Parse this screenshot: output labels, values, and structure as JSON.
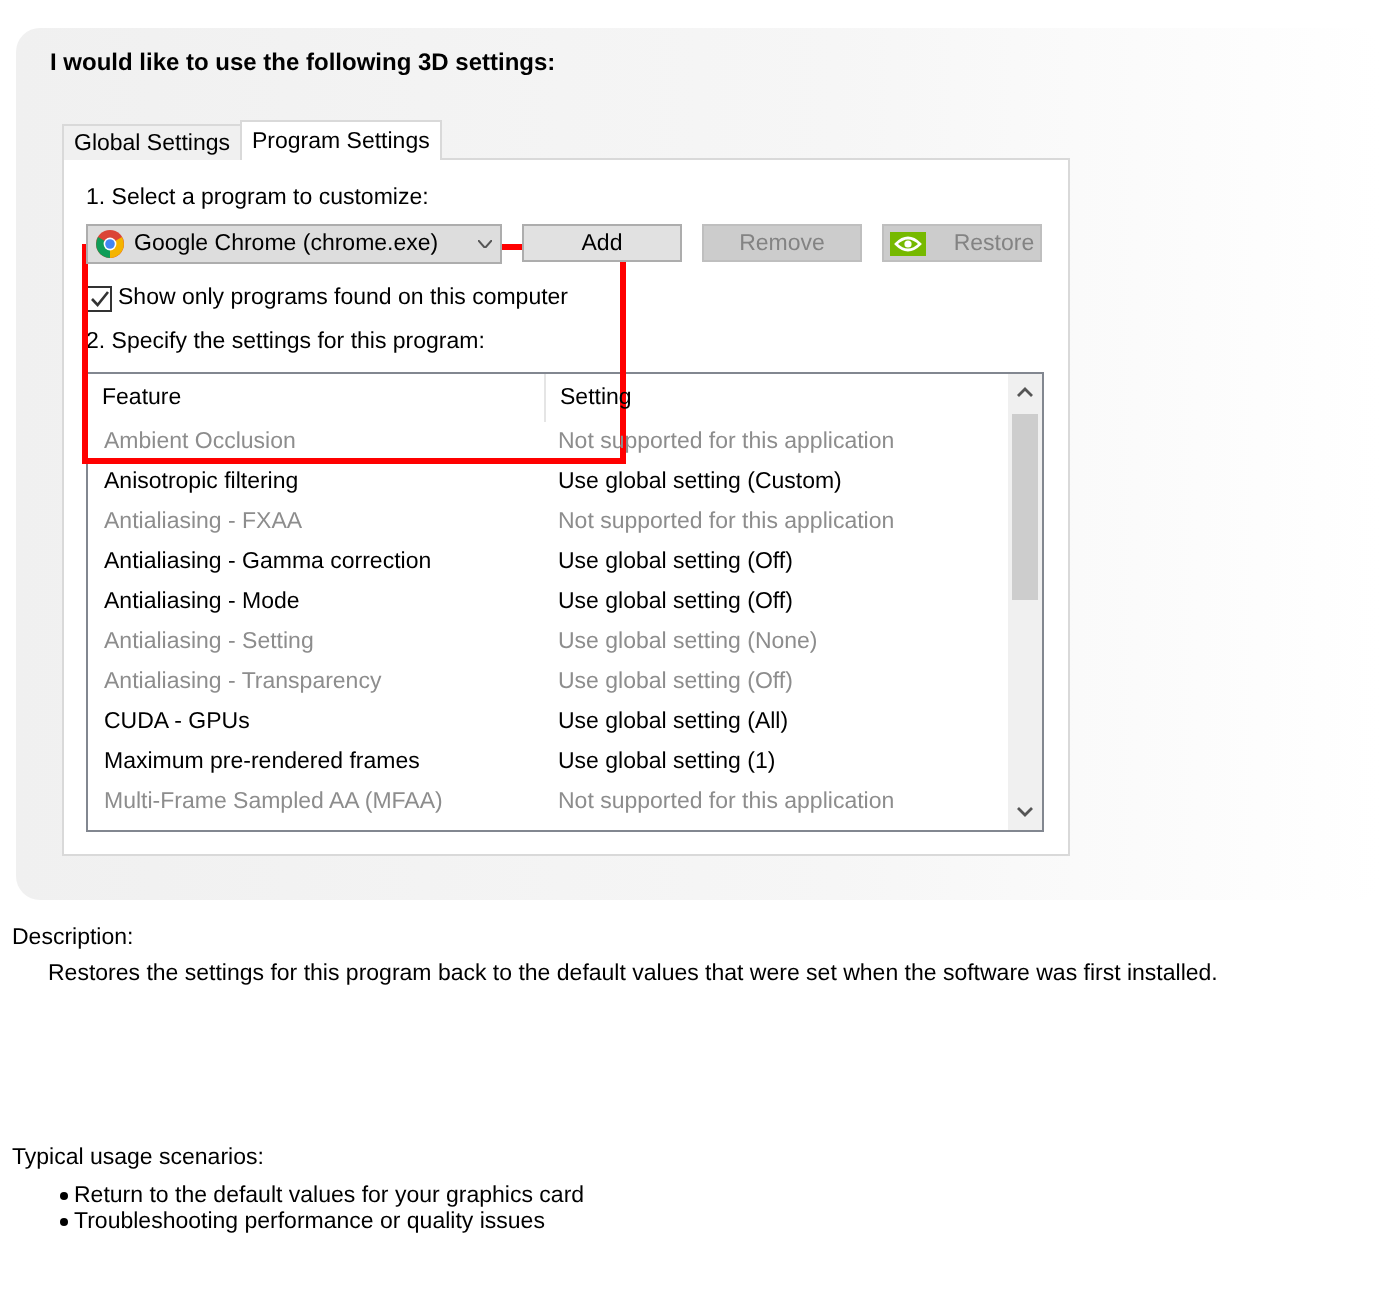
{
  "heading": "I would like to use the following 3D settings:",
  "tabs": [
    {
      "label": "Global Settings",
      "selected": false
    },
    {
      "label": "Program Settings",
      "selected": true
    }
  ],
  "step1": "1. Select a program to customize:",
  "program_select": {
    "value": "Google Chrome (chrome.exe)"
  },
  "buttons": [
    {
      "label": "Add",
      "disabled": false,
      "kind": "plain"
    },
    {
      "label": "Remove",
      "disabled": true,
      "kind": "plain"
    },
    {
      "label": "Restore",
      "disabled": true,
      "kind": "logo"
    }
  ],
  "show_only_checkbox": {
    "label": "Show only programs found on this computer",
    "checked": true
  },
  "step2": "2. Specify the settings for this program:",
  "table": {
    "columns": [
      "Feature",
      "Setting"
    ],
    "rows": [
      {
        "feature": "Ambient Occlusion",
        "setting": "Not supported for this application",
        "disabled": true
      },
      {
        "feature": "Anisotropic filtering",
        "setting": "Use global setting (Custom)",
        "disabled": false
      },
      {
        "feature": "Antialiasing - FXAA",
        "setting": "Not supported for this application",
        "disabled": true
      },
      {
        "feature": "Antialiasing - Gamma correction",
        "setting": "Use global setting (Off)",
        "disabled": false
      },
      {
        "feature": "Antialiasing - Mode",
        "setting": "Use global setting (Off)",
        "disabled": false
      },
      {
        "feature": "Antialiasing - Setting",
        "setting": "Use global setting (None)",
        "disabled": true
      },
      {
        "feature": "Antialiasing - Transparency",
        "setting": "Use global setting (Off)",
        "disabled": true
      },
      {
        "feature": "CUDA - GPUs",
        "setting": "Use global setting (All)",
        "disabled": false
      },
      {
        "feature": "Maximum pre-rendered frames",
        "setting": "Use global setting (1)",
        "disabled": false
      },
      {
        "feature": "Multi-Frame Sampled AA (MFAA)",
        "setting": "Not supported for this application",
        "disabled": true
      }
    ]
  },
  "annotation": {
    "kind": "rectangle"
  },
  "description": {
    "label": "Description:",
    "text": "Restores the settings for this program back to the default values that were set when the software was first installed."
  },
  "usage": {
    "label": "Typical usage scenarios:",
    "items": [
      "Return to the default values for your graphics card",
      "Troubleshooting performance or quality issues"
    ]
  }
}
